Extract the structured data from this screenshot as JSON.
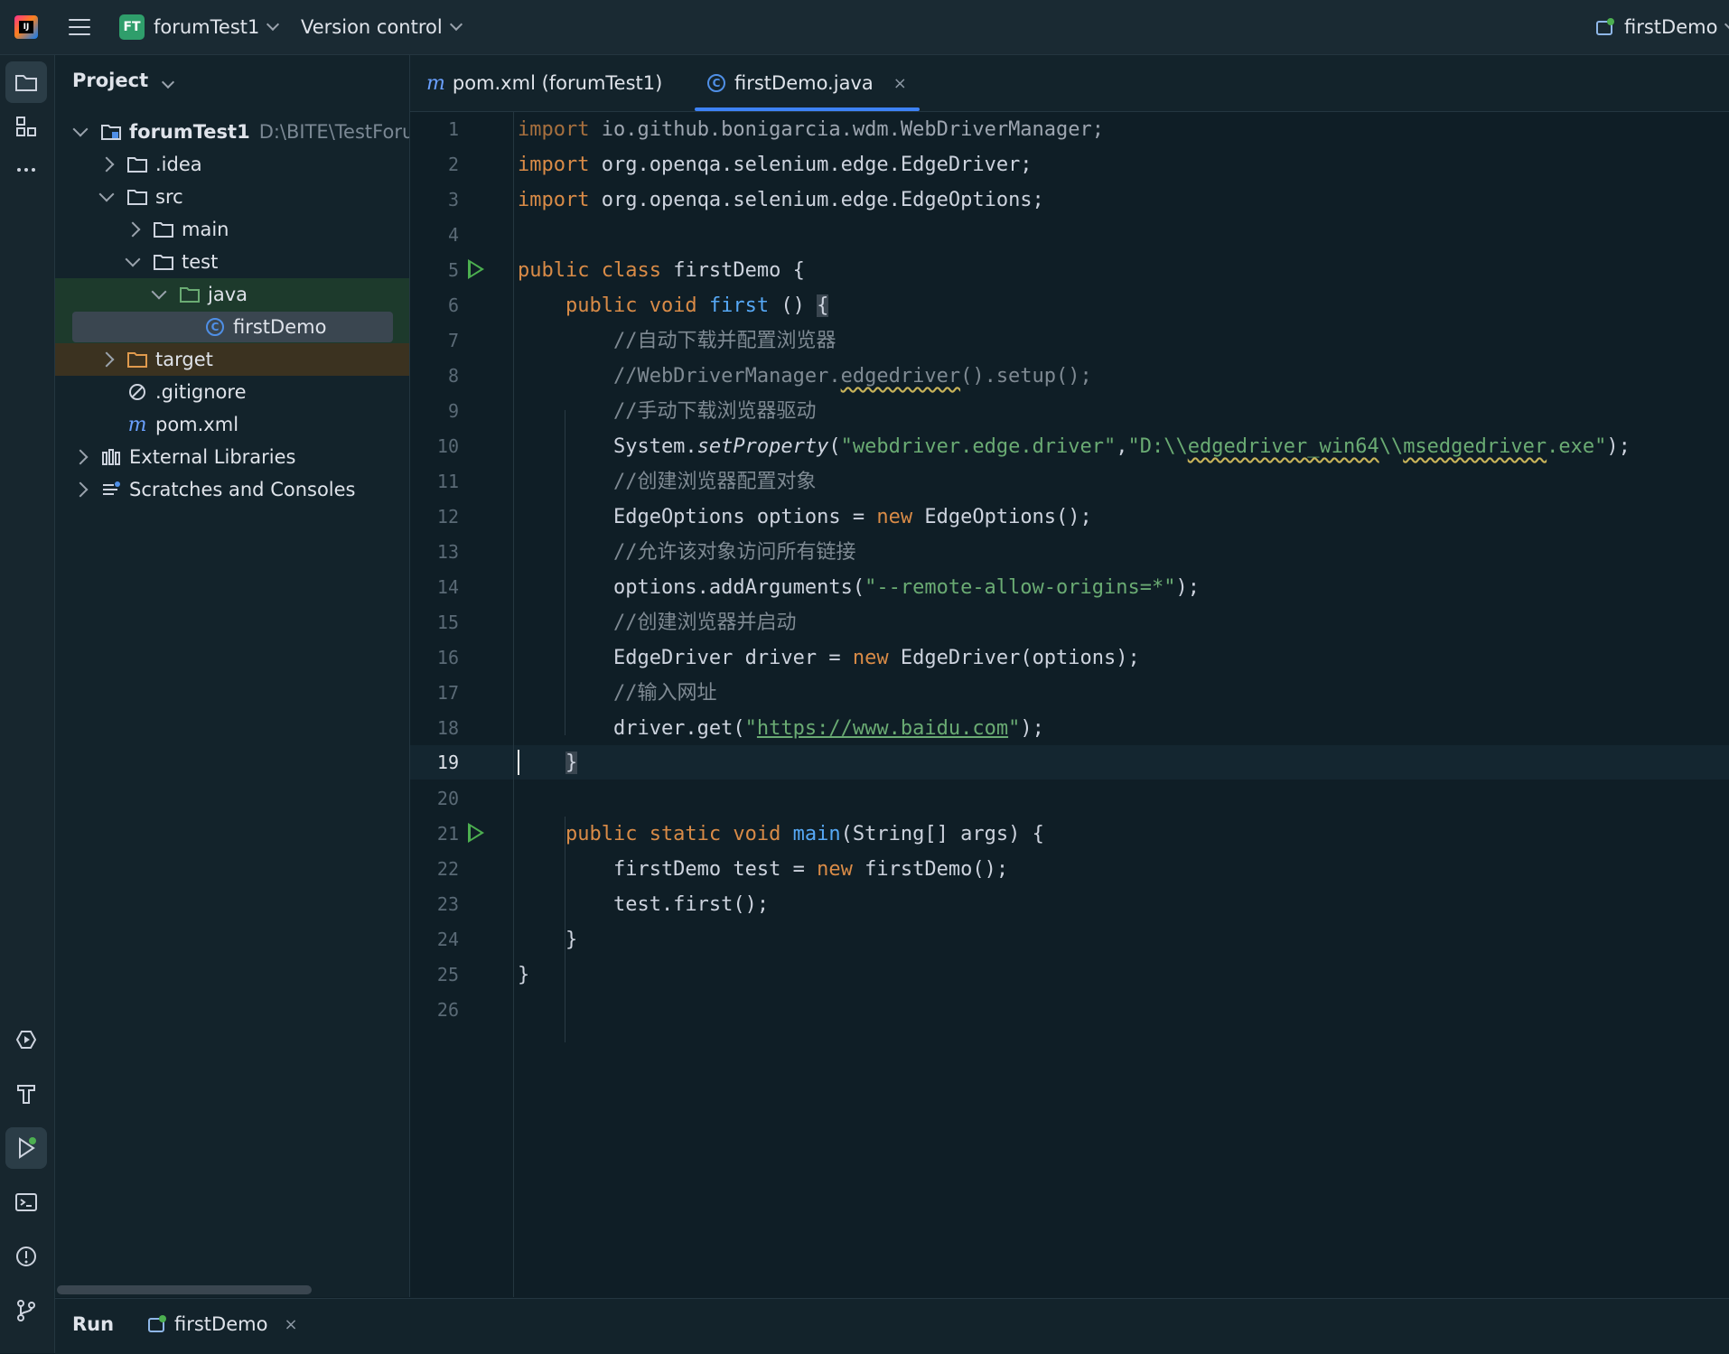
{
  "titlebar": {
    "project_badge": "FT",
    "project_name": "forumTest1",
    "vcs_label": "Version control",
    "run_config": "firstDemo"
  },
  "project_panel": {
    "title": "Project",
    "tree": [
      {
        "label": "forumTest1",
        "hint": "D:\\BITE\\TestForun",
        "icon": "module-folder-icon"
      },
      {
        "label": ".idea",
        "icon": "folder-icon"
      },
      {
        "label": "src",
        "icon": "folder-icon"
      },
      {
        "label": "main",
        "icon": "folder-icon"
      },
      {
        "label": "test",
        "icon": "folder-icon"
      },
      {
        "label": "java",
        "icon": "test-source-folder-icon"
      },
      {
        "label": "firstDemo",
        "icon": "class-icon"
      },
      {
        "label": "target",
        "icon": "excluded-folder-icon"
      },
      {
        "label": ".gitignore",
        "icon": "ignore-file-icon"
      },
      {
        "label": "pom.xml",
        "icon": "maven-icon"
      },
      {
        "label": "External Libraries",
        "icon": "libraries-icon"
      },
      {
        "label": "Scratches and Consoles",
        "icon": "scratches-icon"
      }
    ]
  },
  "tabs": [
    {
      "label": "pom.xml (forumTest1)",
      "icon": "maven-icon"
    },
    {
      "label": "firstDemo.java",
      "icon": "class-icon",
      "close": "×"
    }
  ],
  "editor": {
    "current_line": 19,
    "lines": [
      "1",
      "2",
      "3",
      "4",
      "5",
      "6",
      "7",
      "8",
      "9",
      "10",
      "11",
      "12",
      "13",
      "14",
      "15",
      "16",
      "17",
      "18",
      "19",
      "20",
      "21",
      "22",
      "23",
      "24",
      "25",
      "26"
    ],
    "code": {
      "l1a": "import",
      "l1b": " io.github.bonigarcia.wdm.WebDriverManager;",
      "l2a": "import",
      "l2b": " org.openqa.selenium.edge.EdgeDriver;",
      "l3a": "import",
      "l3b": " org.openqa.selenium.edge.EdgeOptions;",
      "l5a": "public class",
      "l5b": " firstDemo {",
      "l6a": "    public void",
      "l6b": "first",
      "l6c": " () ",
      "l6d": "{",
      "l7": "        //自动下载并配置浏览器",
      "l8a": "        //WebDriverManager.",
      "l8b": "edgedriver",
      "l8c": "().setup();",
      "l9": "        //手动下载浏览器驱动",
      "l10a": "        System.",
      "l10b": "setProperty",
      "l10c": "(",
      "l10d": "\"webdriver.edge.driver\"",
      "l10e": ",",
      "l10f": "\"D:\\\\",
      "l10g": "edgedriver_win64",
      "l10h": "\\\\",
      "l10i": "msedgedriver",
      "l10j": ".exe\"",
      "l10k": ");",
      "l11": "        //创建浏览器配置对象",
      "l12a": "        EdgeOptions options = ",
      "l12b": "new",
      "l12c": " EdgeOptions();",
      "l13": "        //允许该对象访问所有链接",
      "l14a": "        options.addArguments(",
      "l14b": "\"--remote-allow-origins=*\"",
      "l14c": ");",
      "l15": "        //创建浏览器并启动",
      "l16a": "        EdgeDriver driver = ",
      "l16b": "new",
      "l16c": " EdgeDriver(options);",
      "l17": "        //输入网址",
      "l18a": "        driver.get(",
      "l18b": "\"",
      "l18c": "https://www.baidu.com",
      "l18d": "\"",
      "l18e": ");",
      "l19a": "    ",
      "l19b": "}",
      "l21a": "    public static void",
      "l21b": "main",
      "l21c": "(String[] args) {",
      "l22a": "        firstDemo test = ",
      "l22b": "new",
      "l22c": " firstDemo();",
      "l23": "        test.first();",
      "l24": "    }",
      "l25": "}"
    }
  },
  "bottombar": {
    "run_label": "Run",
    "run_tab": "firstDemo",
    "close": "×"
  },
  "colors": {
    "accent": "#3d82f6",
    "keyword": "#d98b47",
    "string": "#6aab73",
    "comment": "#7f8a93",
    "function": "#56a8f5",
    "run_green": "#4caf50"
  }
}
